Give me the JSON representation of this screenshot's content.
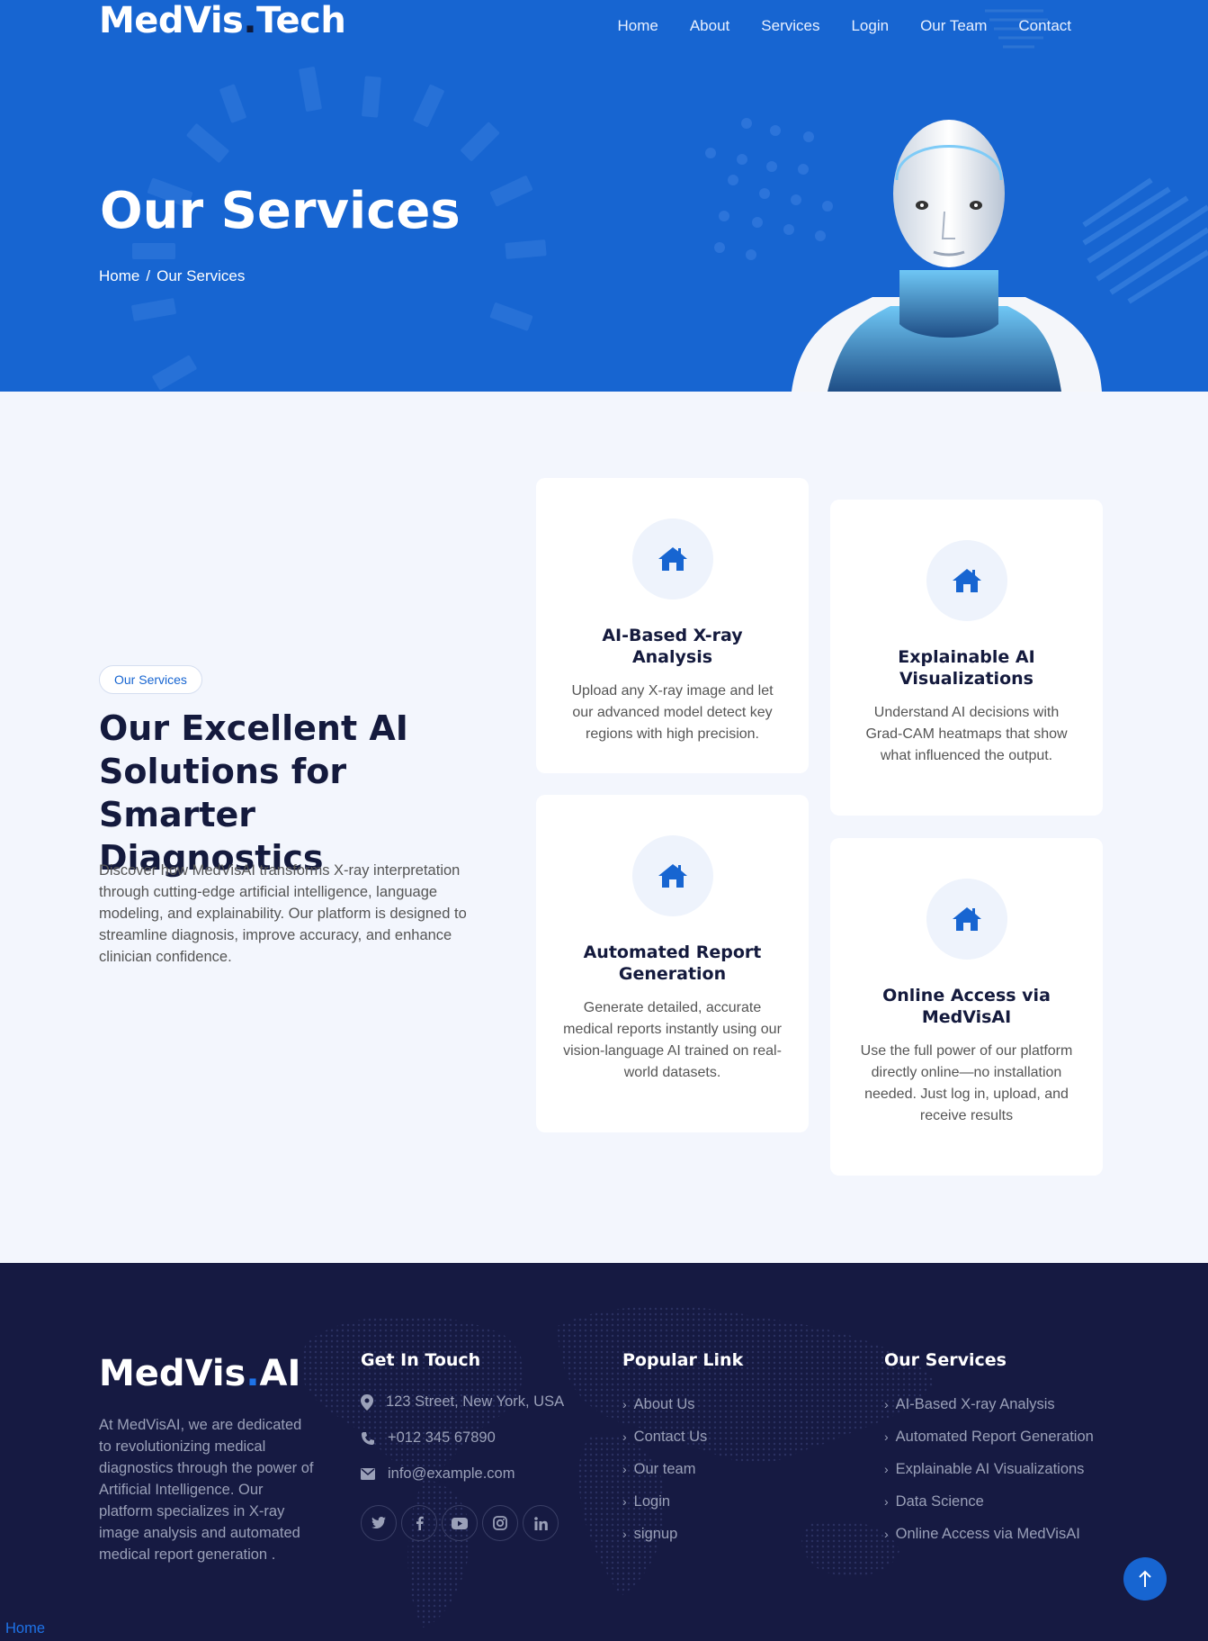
{
  "header": {
    "logo_main": "MedVis",
    "logo_dot": ".",
    "logo_end": "Tech",
    "nav": [
      "Home",
      "About",
      "Services",
      "Login",
      "Our Team",
      "Contact"
    ]
  },
  "hero": {
    "title": "Our Services",
    "breadcrumb_home": "Home",
    "breadcrumb_sep": "/",
    "breadcrumb_current": "Our Services"
  },
  "services": {
    "tag": "Our Services",
    "heading": "Our Excellent AI Solutions for Smarter Diagnostics",
    "intro": "Discover how MedVisAI transforms X-ray interpretation through cutting-edge artificial intelligence, language modeling, and explainability. Our platform is designed to streamline diagnosis, improve accuracy, and enhance clinician confidence.",
    "cards": [
      {
        "icon": "home-icon",
        "title": "AI-Based X-ray Analysis",
        "text": "Upload any X-ray image and let our advanced model detect key regions with high precision."
      },
      {
        "icon": "home-icon",
        "title": "Explainable AI Visualizations",
        "text": "Understand AI decisions with Grad-CAM heatmaps that show what influenced the output."
      },
      {
        "icon": "home-icon",
        "title": "Automated Report Generation",
        "text": "Generate detailed, accurate medical reports instantly using our vision-language AI trained on real-world datasets."
      },
      {
        "icon": "home-icon",
        "title": "Online Access via MedVisAI",
        "text": "Use the full power of our platform directly online—no installation needed. Just log in, upload, and receive results"
      }
    ]
  },
  "footer": {
    "logo_main": "MedVis",
    "logo_dot": ".",
    "logo_end": "AI",
    "about": "At MedVisAI, we are dedicated to revolutionizing medical diagnostics through the power of Artificial Intelligence. Our platform specializes in X-ray image analysis and automated medical report generation .",
    "contact_title": "Get In Touch",
    "address": "123 Street, New York, USA",
    "phone": "+012 345 67890",
    "email": "info@example.com",
    "socials": [
      "twitter-icon",
      "facebook-icon",
      "youtube-icon",
      "instagram-icon",
      "linkedin-icon"
    ],
    "popular_title": "Popular Link",
    "popular_links": [
      "About Us",
      "Contact Us",
      "Our team",
      "Login",
      "signup"
    ],
    "services_title": "Our Services",
    "service_links": [
      "AI-Based X-ray Analysis",
      "Automated Report Generation",
      "Explainable AI Visualizations",
      "Data Science",
      "Online Access via MedVisAI"
    ],
    "bottom_link": "Home"
  },
  "colors": {
    "primary": "#1765d1",
    "dark": "#141a3d",
    "footer_bg": "#161a42",
    "section_bg": "#f3f6fd"
  }
}
